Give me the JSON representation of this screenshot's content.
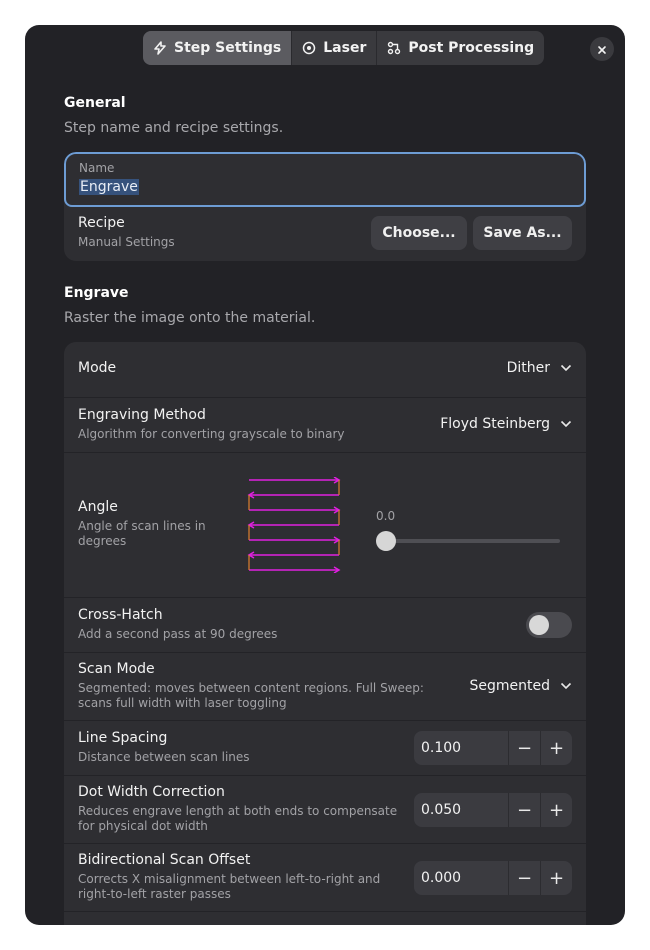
{
  "header": {
    "tabs": [
      {
        "label": "Step Settings",
        "icon": "bolt-icon",
        "active": true
      },
      {
        "label": "Laser",
        "icon": "target-icon",
        "active": false
      },
      {
        "label": "Post Processing",
        "icon": "workflow-icon",
        "active": false
      }
    ],
    "close_icon": "close-icon"
  },
  "general": {
    "title": "General",
    "subtitle": "Step name and recipe settings.",
    "name_label": "Name",
    "name_value": "Engrave",
    "recipe_title": "Recipe",
    "recipe_subtitle": "Manual Settings",
    "choose_label": "Choose...",
    "save_as_label": "Save As..."
  },
  "engrave": {
    "title": "Engrave",
    "subtitle": "Raster the image onto the material.",
    "mode": {
      "title": "Mode",
      "value": "Dither"
    },
    "method": {
      "title": "Engraving Method",
      "subtitle": "Algorithm for converting grayscale to binary",
      "value": "Floyd Steinberg"
    },
    "angle": {
      "title": "Angle",
      "subtitle": "Angle of scan lines in degrees",
      "value": "0.0",
      "level": 0.0
    },
    "cross_hatch": {
      "title": "Cross-Hatch",
      "subtitle": "Add a second pass at 90 degrees",
      "enabled": false
    },
    "scan_mode": {
      "title": "Scan Mode",
      "subtitle": "Segmented: moves between content regions. Full Sweep: scans full width with laser toggling",
      "value": "Segmented"
    },
    "line_spacing": {
      "title": "Line Spacing",
      "subtitle": "Distance between scan lines",
      "value": "0.100"
    },
    "dot_width": {
      "title": "Dot Width Correction",
      "subtitle": "Reduces engrave length at both ends to compensate for physical dot width",
      "value": "0.050"
    },
    "bidirectional": {
      "title": "Bidirectional Scan Offset",
      "subtitle": "Corrects X misalignment between left-to-right and right-to-left raster passes",
      "value": "0.000"
    }
  },
  "colors": {
    "accent_focus": "#6d9cd4",
    "scan_preview_lines": "#e020e0",
    "scan_preview_turns": "#e08030"
  },
  "spin_minus": "−",
  "spin_plus": "+"
}
